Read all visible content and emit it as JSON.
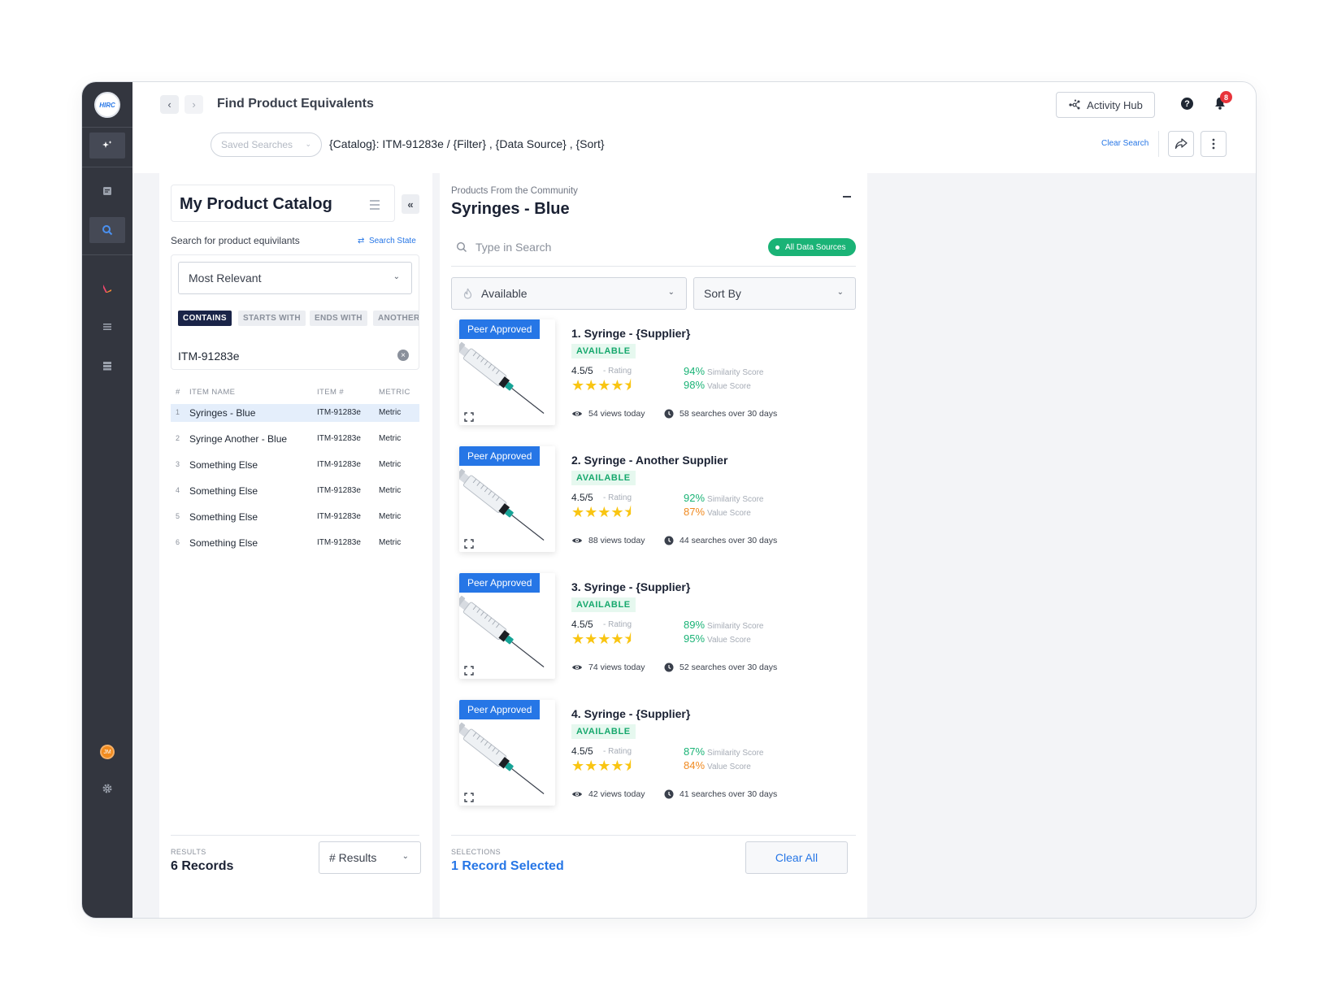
{
  "sidebar": {
    "logo_text": "HIRC",
    "avatar_initials": "JM"
  },
  "header": {
    "title": "Find Product Equivalents",
    "activity_hub": "Activity Hub",
    "notifications_count": "8",
    "saved_searches_placeholder": "Saved Searches",
    "query": "{Catalog}: ITM-91283e  /  {Filter} , {Data Source} , {Sort}",
    "clear_search": "Clear Search"
  },
  "catalog": {
    "title": "My Product Catalog",
    "search_label": "Search for product equivilants",
    "search_state": "Search State",
    "relevance": "Most Relevant",
    "match_options": [
      "CONTAINS",
      "STARTS WITH",
      "ENDS WITH",
      "ANOTHER"
    ],
    "selected_match": "CONTAINS",
    "filter_value": "ITM-91283e",
    "columns": {
      "num": "#",
      "name": "ITEM NAME",
      "item": "ITEM #",
      "metric": "METRIC"
    },
    "rows": [
      {
        "num": "1",
        "name": "Syringes - Blue",
        "item": "ITM-91283e",
        "metric": "Metric"
      },
      {
        "num": "2",
        "name": "Syringe Another - Blue",
        "item": "ITM-91283e",
        "metric": "Metric"
      },
      {
        "num": "3",
        "name": "Something Else",
        "item": "ITM-91283e",
        "metric": "Metric"
      },
      {
        "num": "4",
        "name": "Something Else",
        "item": "ITM-91283e",
        "metric": "Metric"
      },
      {
        "num": "5",
        "name": "Something Else",
        "item": "ITM-91283e",
        "metric": "Metric"
      },
      {
        "num": "6",
        "name": "Something Else",
        "item": "ITM-91283e",
        "metric": "Metric"
      }
    ],
    "results_label": "RESULTS",
    "results_value": "6 Records",
    "results_select": "# Results"
  },
  "community": {
    "subtitle": "Products From the Community",
    "title": "Syringes - Blue",
    "search_placeholder": "Type in Search",
    "data_sources": "All Data Sources",
    "availability": "Available",
    "sort": "Sort By",
    "products": [
      {
        "badge": "Peer Approved",
        "name": "1. Syringe - {Supplier}",
        "status": "AVAILABLE",
        "rating": "4.5/5",
        "rating_label": "- Rating",
        "stars": 4.5,
        "similarity": "94%",
        "similarity_label": "Similarity Score",
        "similarity_color": "#1ab376",
        "value": "98%",
        "value_label": "Value Score",
        "value_color": "#1ab376",
        "views": "54 views today",
        "searches": "58 searches over 30 days"
      },
      {
        "badge": "Peer Approved",
        "name": "2. Syringe - Another Supplier",
        "status": "AVAILABLE",
        "rating": "4.5/5",
        "rating_label": "- Rating",
        "stars": 4.5,
        "similarity": "92%",
        "similarity_label": "Similarity Score",
        "similarity_color": "#1ab376",
        "value": "87%",
        "value_label": "Value Score",
        "value_color": "#f08a21",
        "views": "88 views today",
        "searches": "44 searches over 30 days"
      },
      {
        "badge": "Peer Approved",
        "name": "3. Syringe - {Supplier}",
        "status": "AVAILABLE",
        "rating": "4.5/5",
        "rating_label": "- Rating",
        "stars": 4.5,
        "similarity": "89%",
        "similarity_label": "Similarity Score",
        "similarity_color": "#1ab376",
        "value": "95%",
        "value_label": "Value Score",
        "value_color": "#1ab376",
        "views": "74 views today",
        "searches": "52 searches over 30 days"
      },
      {
        "badge": "Peer Approved",
        "name": "4. Syringe - {Supplier}",
        "status": "AVAILABLE",
        "rating": "4.5/5",
        "rating_label": "- Rating",
        "stars": 4.5,
        "similarity": "87%",
        "similarity_label": "Similarity Score",
        "similarity_color": "#1ab376",
        "value": "84%",
        "value_label": "Value Score",
        "value_color": "#f08a21",
        "views": "42 views today",
        "searches": "41 searches over 30 days"
      }
    ],
    "selections_label": "SELECTIONS",
    "selections_value": "1 Record Selected",
    "clear_all": "Clear All"
  },
  "colors": {
    "accent": "#2676e6",
    "success": "#1ab376",
    "warning": "#f08a21",
    "sidebar": "#33363f",
    "star": "#f9c512"
  }
}
